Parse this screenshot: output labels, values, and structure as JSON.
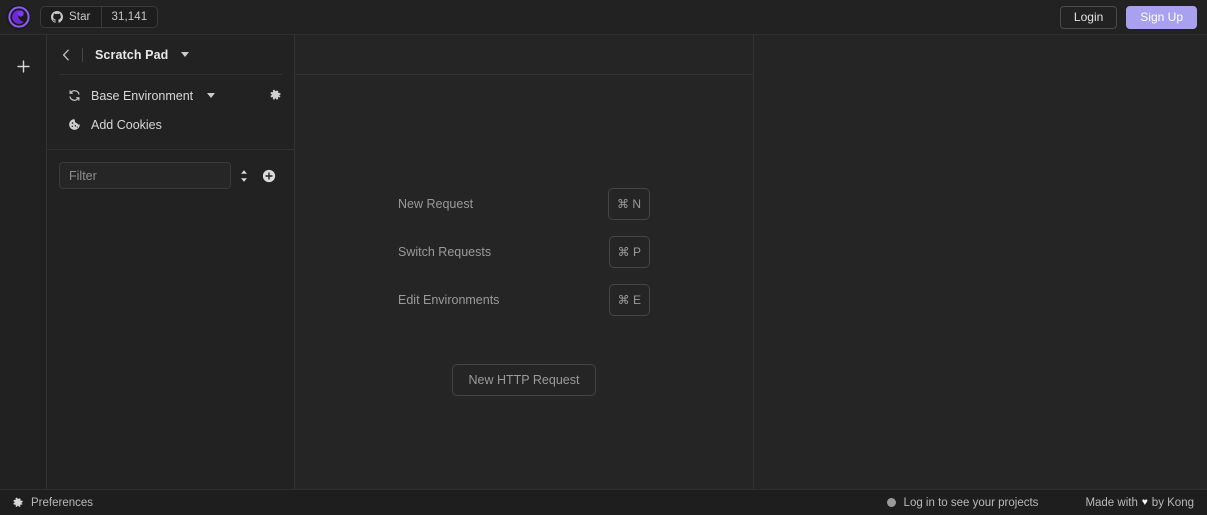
{
  "header": {
    "logo_icon": "insomnia-logo-icon",
    "github_icon": "github-icon",
    "star_label": "Star",
    "star_count": "31,141",
    "login_label": "Login",
    "signup_label": "Sign Up",
    "signup_color": "#a9a1f0"
  },
  "rail": {
    "add_icon": "plus-icon"
  },
  "sidebar": {
    "back_icon": "chevron-left-icon",
    "title": "Scratch Pad",
    "title_caret_icon": "chevron-down-icon",
    "rows": [
      {
        "icon": "sync-icon",
        "label": "Base Environment",
        "caret": true,
        "gear": true
      },
      {
        "icon": "cookie-icon",
        "label": "Add Cookies",
        "caret": false,
        "gear": false
      }
    ],
    "environment_label": "Base Environment",
    "cookies_label": "Add Cookies",
    "gear_icon": "gear-icon",
    "filter_placeholder": "Filter",
    "filter_value": "",
    "sort_icon": "sort-updown-icon",
    "add_icon": "plus-circle-icon"
  },
  "center": {
    "shortcuts": [
      {
        "label": "New Request",
        "key": "⌘ N"
      },
      {
        "label": "Switch Requests",
        "key": "⌘ P"
      },
      {
        "label": "Edit Environments",
        "key": "⌘ E"
      }
    ],
    "new_request_button": "New HTTP Request"
  },
  "footer": {
    "preferences_icon": "gear-icon",
    "preferences_label": "Preferences",
    "status_dot_color": "#9a9a9a",
    "projects_label": "Log in to see your projects",
    "made_prefix": "Made with",
    "made_heart": "♥",
    "made_suffix": "by Kong"
  }
}
